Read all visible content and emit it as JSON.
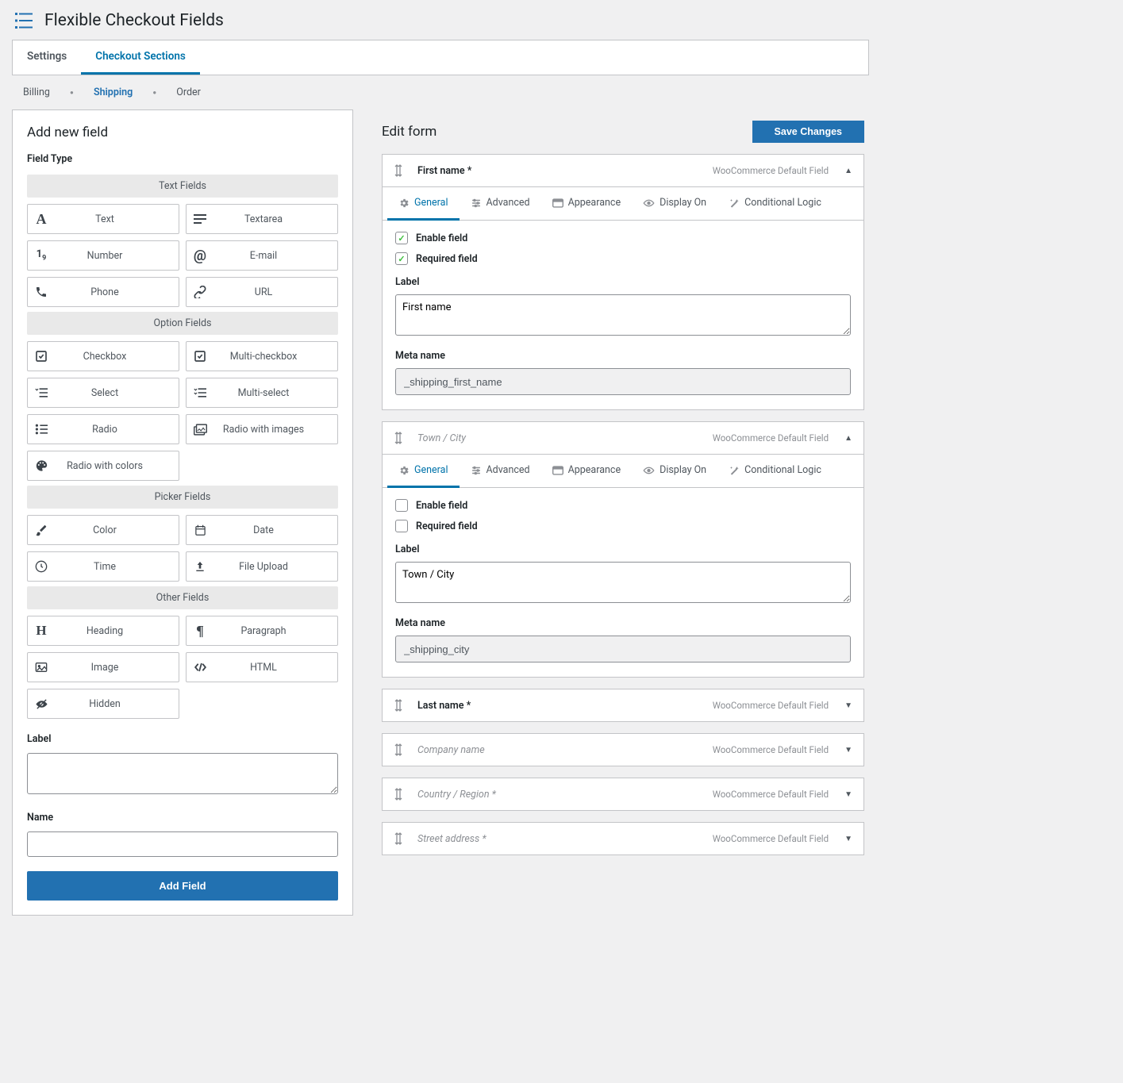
{
  "header": {
    "title": "Flexible Checkout Fields"
  },
  "tabs": {
    "settings": "Settings",
    "sections": "Checkout Sections"
  },
  "breadcrumb": {
    "billing": "Billing",
    "shipping": "Shipping",
    "order": "Order"
  },
  "left": {
    "title": "Add new field",
    "field_type_label": "Field Type",
    "cats": {
      "text": "Text Fields",
      "option": "Option Fields",
      "picker": "Picker Fields",
      "other": "Other Fields"
    },
    "tiles": {
      "text": "Text",
      "textarea": "Textarea",
      "number": "Number",
      "email": "E-mail",
      "phone": "Phone",
      "url": "URL",
      "checkbox": "Checkbox",
      "multicheckbox": "Multi-checkbox",
      "select": "Select",
      "multiselect": "Multi-select",
      "radio": "Radio",
      "radioimages": "Radio with images",
      "radiocolors": "Radio with colors",
      "color": "Color",
      "date": "Date",
      "time": "Time",
      "file": "File Upload",
      "heading": "Heading",
      "paragraph": "Paragraph",
      "image": "Image",
      "html": "HTML",
      "hidden": "Hidden"
    },
    "label_label": "Label",
    "name_label": "Name",
    "add_button": "Add Field"
  },
  "right": {
    "title": "Edit form",
    "save": "Save Changes",
    "default_badge": "WooCommerce Default Field",
    "inner_tabs": {
      "general": "General",
      "advanced": "Advanced",
      "appearance": "Appearance",
      "displayon": "Display On",
      "logic": "Conditional Logic"
    },
    "labels": {
      "enable": "Enable field",
      "required": "Required field",
      "label": "Label",
      "meta": "Meta name"
    },
    "rows": [
      {
        "name": "First name *",
        "disabled": false,
        "expanded": true,
        "enable": true,
        "required": true,
        "label_value": "First name",
        "meta_value": "_shipping_first_name"
      },
      {
        "name": "Town / City",
        "disabled": true,
        "expanded": true,
        "enable": false,
        "required": false,
        "label_value": "Town / City",
        "meta_value": "_shipping_city"
      },
      {
        "name": "Last name *",
        "disabled": false,
        "expanded": false
      },
      {
        "name": "Company name",
        "disabled": true,
        "expanded": false
      },
      {
        "name": "Country / Region *",
        "disabled": true,
        "expanded": false
      },
      {
        "name": "Street address *",
        "disabled": true,
        "expanded": false
      }
    ]
  }
}
